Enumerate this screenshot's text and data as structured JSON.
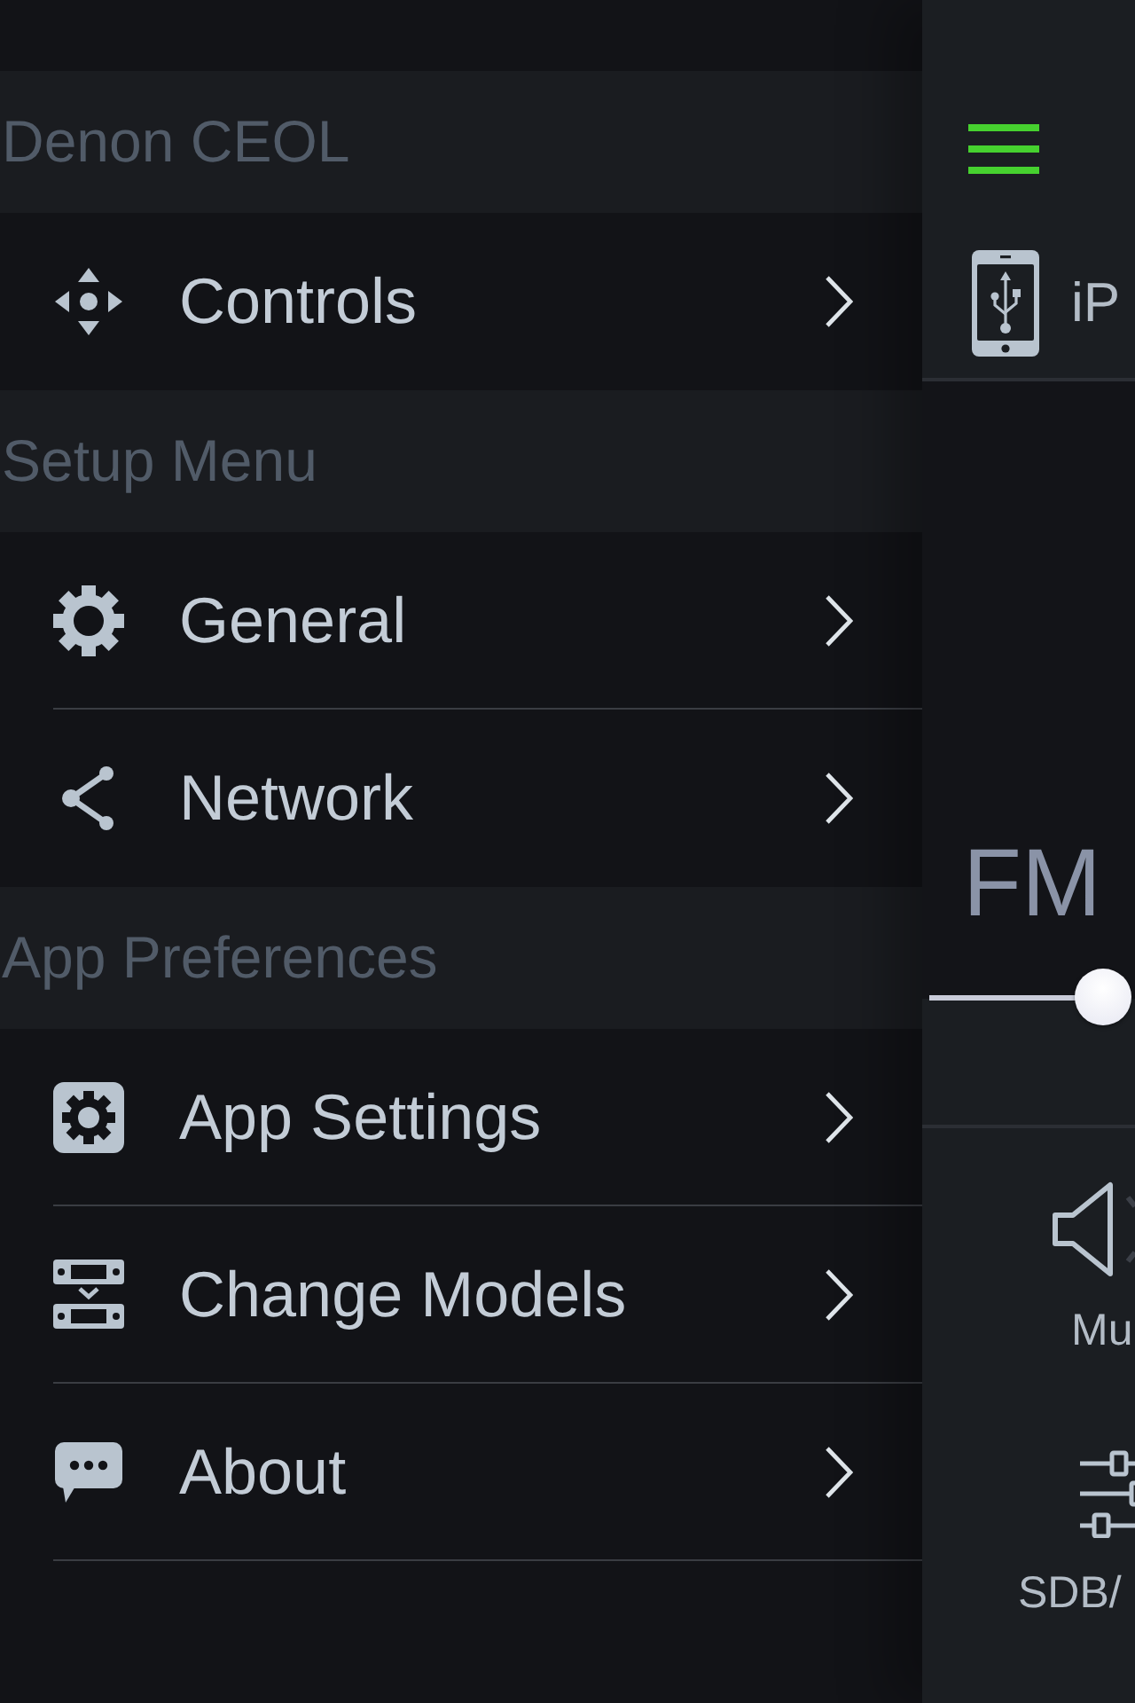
{
  "menu": {
    "sections": [
      {
        "header": "Denon CEOL",
        "items": [
          {
            "label": "Controls"
          }
        ]
      },
      {
        "header": "Setup Menu",
        "items": [
          {
            "label": "General"
          },
          {
            "label": "Network"
          }
        ]
      },
      {
        "header": "App Preferences",
        "items": [
          {
            "label": "App Settings"
          },
          {
            "label": "Change Models"
          },
          {
            "label": "About"
          }
        ]
      }
    ]
  },
  "player": {
    "source": "iP",
    "band": "FM",
    "tuner": {
      "level": 0.845
    },
    "buttons": [
      {
        "label": "Mu"
      },
      {
        "label": "SDB/"
      }
    ]
  }
}
